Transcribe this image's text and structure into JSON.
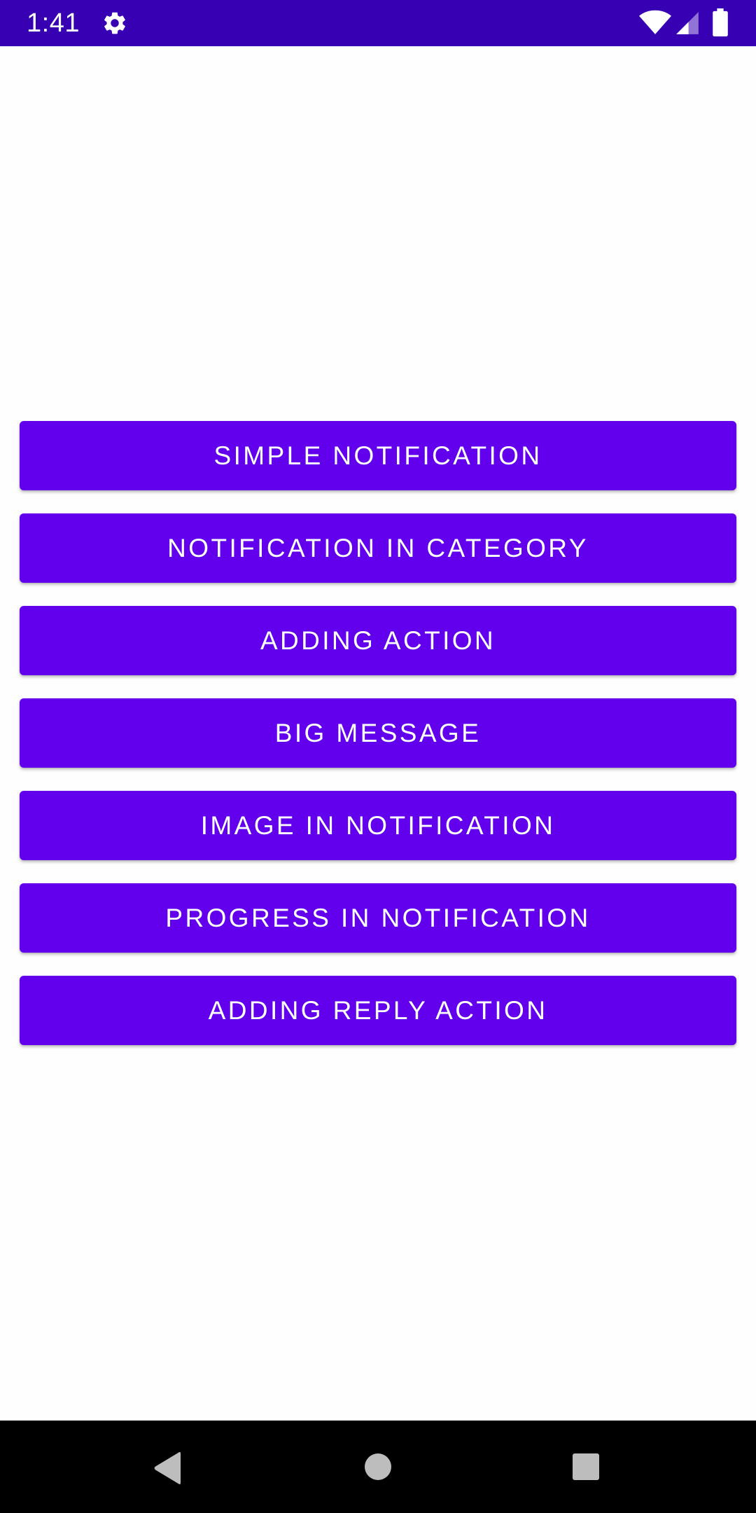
{
  "status_bar": {
    "time": "1:41",
    "icons": [
      "gear-icon",
      "wifi-icon",
      "cellular-signal-icon",
      "battery-icon"
    ],
    "background": "#3700B3"
  },
  "buttons": [
    {
      "label": "SIMPLE NOTIFICATION"
    },
    {
      "label": "NOTIFICATION IN CATEGORY"
    },
    {
      "label": "ADDING ACTION"
    },
    {
      "label": "BIG MESSAGE"
    },
    {
      "label": "IMAGE IN NOTIFICATION"
    },
    {
      "label": "PROGRESS IN NOTIFICATION"
    },
    {
      "label": "ADDING REPLY ACTION"
    }
  ],
  "navigation_bar": {
    "icons": [
      "back-icon",
      "home-icon",
      "recents-icon"
    ],
    "background": "#000000"
  },
  "colors": {
    "button_background": "#6200EE",
    "button_text": "#FFFFFF",
    "page_background": "#FEFEFE"
  }
}
